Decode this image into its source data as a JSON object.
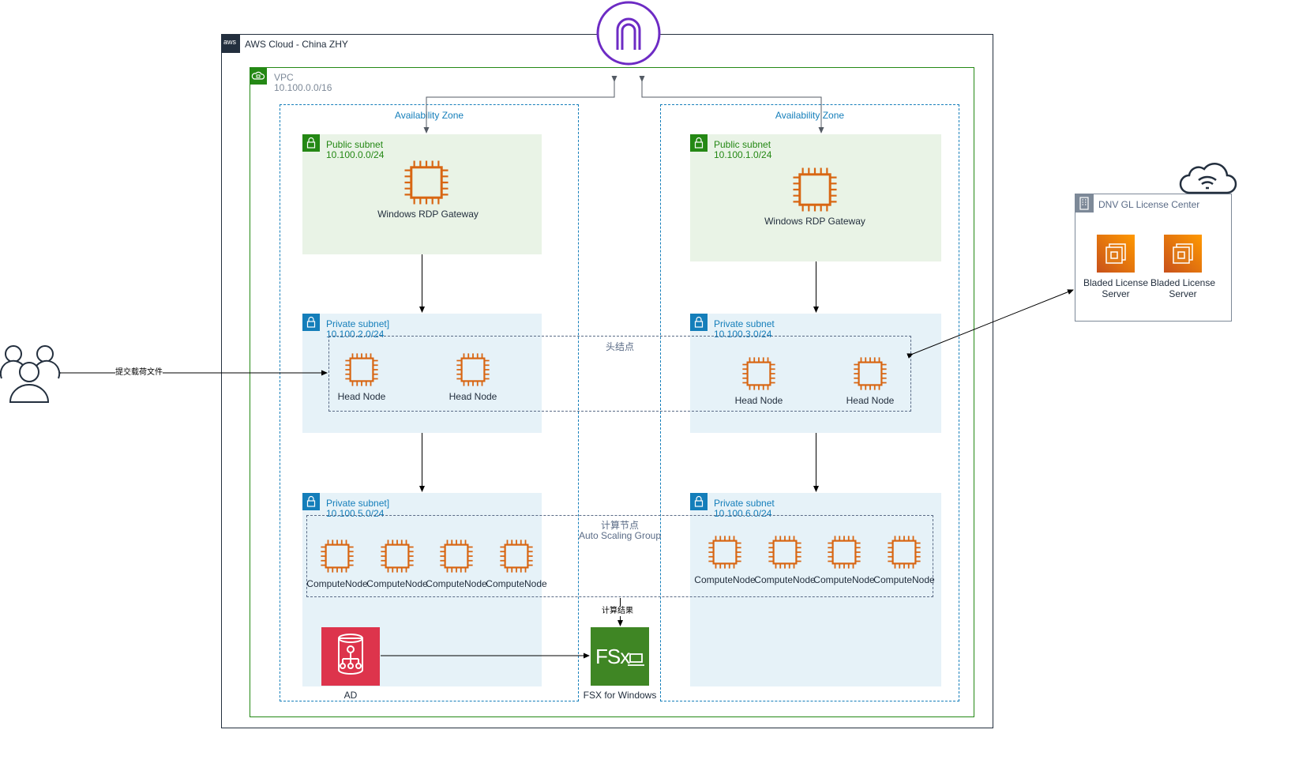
{
  "aws_cloud": {
    "label": "AWS Cloud - China ZHY",
    "logo_text": "aws"
  },
  "vpc": {
    "name": "VPC",
    "cidr": "10.100.0.0/16"
  },
  "availability_zones": [
    "Availability Zone",
    "Availability Zone"
  ],
  "subnets": {
    "left_public": {
      "name": "Public subnet",
      "cidr": "10.100.0.0/24"
    },
    "right_public": {
      "name": "Public subnet",
      "cidr": "10.100.1.0/24"
    },
    "left_private_head": {
      "name": "Private subnet]",
      "cidr": "10.100.2.0/24"
    },
    "right_private_head": {
      "name": "Private subnet",
      "cidr": "10.100.3.0/24"
    },
    "left_private_compute": {
      "name": "Private subnet]",
      "cidr": "10.100.5.0/24"
    },
    "right_private_compute": {
      "name": "Private subnet",
      "cidr": "10.100.6.0/24"
    }
  },
  "nodes": {
    "rdp_gateway_left": "Windows RDP Gateway",
    "rdp_gateway_right": "Windows RDP Gateway",
    "head_nodes": [
      "Head Node",
      "Head Node",
      "Head Node",
      "Head Node"
    ],
    "compute_nodes_left": [
      "ComputeNode",
      "ComputeNode",
      "ComputeNode",
      "ComputeNode"
    ],
    "compute_nodes_right": [
      "ComputeNode",
      "ComputeNode",
      "ComputeNode",
      "ComputeNode"
    ],
    "ad": "AD",
    "fsx": "FSX for Windows",
    "fsx_logo_text": "FSx"
  },
  "groups": {
    "head_group": "头结点",
    "compute_group_line1": "计算节点",
    "compute_group_line2": "Auto Scaling Group"
  },
  "connections": {
    "users_label": "提交载荷文件",
    "compute_result_label": "计算结果"
  },
  "license_center": {
    "title": "DNV GL  License Center",
    "servers": [
      "Bladed License\nServer",
      "Bladed License\nServer"
    ]
  },
  "icons": {
    "gateway": "internet-gateway-icon",
    "users": "users-icon",
    "cloud": "internet-cloud-icon",
    "ec2": "ec2-instance-icon",
    "ad": "directory-service-icon",
    "fsx": "fsx-windows-icon"
  },
  "colors": {
    "vpc_green": "#248814",
    "az_blue": "#147eba",
    "ec2_orange": "#d86613",
    "gateway_purple": "#6d2bc4",
    "ad_red": "#dd344c",
    "fsx_green": "#3f8624"
  }
}
